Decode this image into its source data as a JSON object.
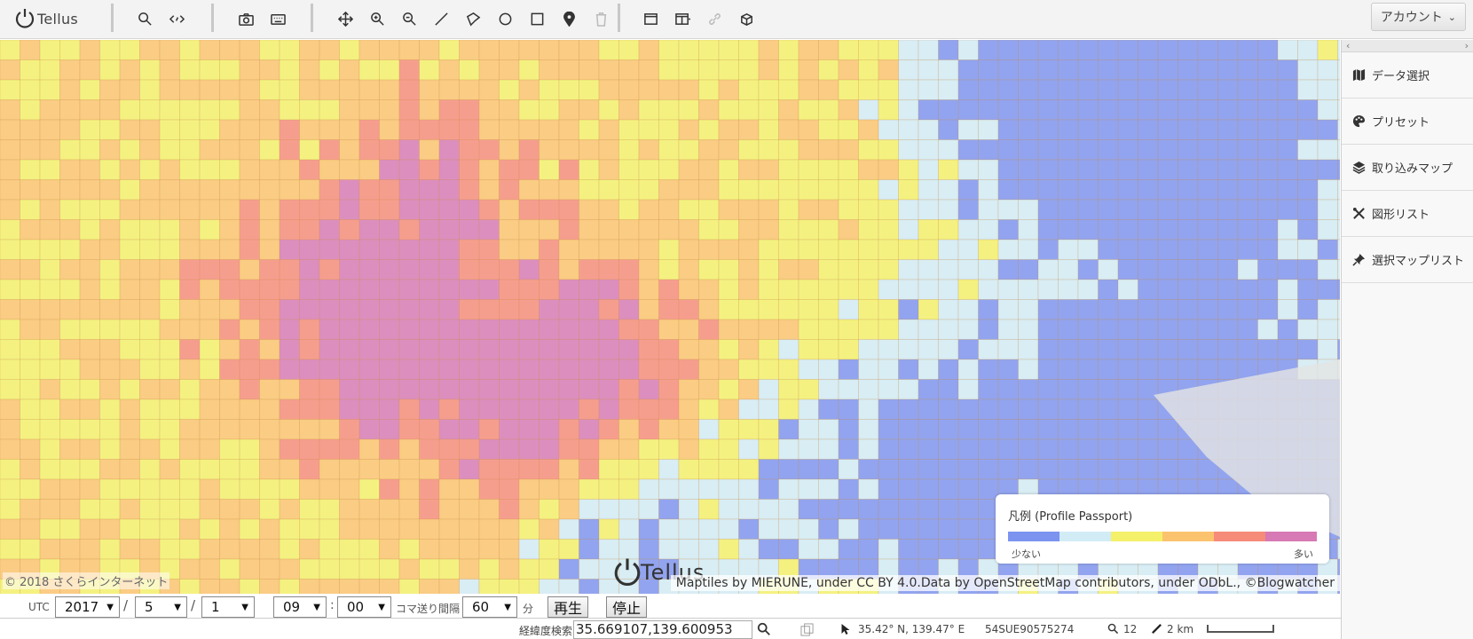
{
  "app": {
    "logo_text": "Tellus"
  },
  "toolbar": {
    "icons": [
      "search-icon",
      "code-icon",
      "camera-icon",
      "keyboard-icon",
      "move-icon",
      "zoom-in-icon",
      "zoom-out-icon",
      "line-icon",
      "polygon-icon",
      "circle-icon",
      "rectangle-icon",
      "marker-icon",
      "trash-icon",
      "single-window-icon",
      "split-window-icon",
      "link-icon",
      "cube-icon"
    ],
    "account_label": "アカウント"
  },
  "sidebar": {
    "items": [
      {
        "label": "データ選択",
        "icon": "map-icon"
      },
      {
        "label": "プリセット",
        "icon": "palette-icon"
      },
      {
        "label": "取り込みマップ",
        "icon": "layers-icon"
      },
      {
        "label": "図形リスト",
        "icon": "shapes-icon"
      },
      {
        "label": "選択マップリスト",
        "icon": "pin-icon"
      }
    ]
  },
  "legend": {
    "title": "凡例 (Profile Passport)",
    "low_label": "少ない",
    "high_label": "多い",
    "colors": [
      "#7c93f0",
      "#d2ecf6",
      "#f4f06a",
      "#fbc36e",
      "#f78b7a",
      "#d779b4"
    ]
  },
  "map": {
    "copyright": "© 2018 さくらインターネット",
    "attribution": "Maptiles by MIERUNE, under CC BY 4.0.Data by OpenStreetMap contributors, under ODbL., ©Blogwatcher",
    "watermark": "Tellus"
  },
  "time_controls": {
    "utc_label": "UTC",
    "year": "2017",
    "month": "5",
    "day": "1",
    "hour": "09",
    "minute": "00",
    "date_sep": "/",
    "time_sep": ":",
    "interval_label": "コマ送り間隔",
    "interval": "60",
    "interval_unit": "分",
    "play_label": "再生",
    "stop_label": "停止"
  },
  "status_bar": {
    "search_label": "経緯度検索",
    "coordinates": "35.669107,139.600953",
    "latlon": "35.42° N, 139.47° E",
    "mesh_code": "54SUE90575274",
    "zoom": "12",
    "scale": "2 km"
  }
}
